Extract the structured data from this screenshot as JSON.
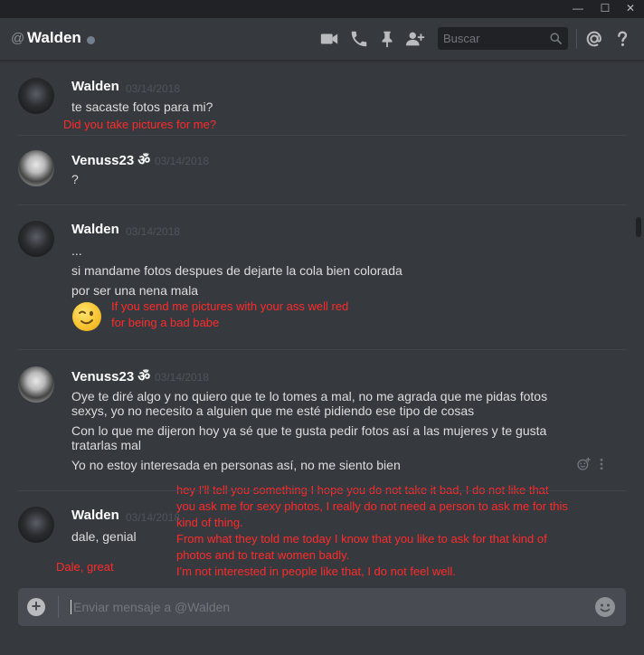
{
  "window": {
    "controls": [
      "—",
      "☐",
      "✕"
    ]
  },
  "header": {
    "at_symbol": "@",
    "channel_name": "Walden",
    "search_placeholder": "Buscar",
    "icons": [
      "video-call-icon",
      "voice-call-icon",
      "pin-icon",
      "add-friend-icon",
      "search-icon",
      "mention-icon",
      "help-icon"
    ]
  },
  "messages": [
    {
      "author": "Walden",
      "timestamp": "03/14/2018",
      "lines": [
        "te sacaste fotos para mi?"
      ],
      "overlay": [
        "Did you take pictures for me?"
      ]
    },
    {
      "author": "Venuss23 ॐ",
      "timestamp": "03/14/2018",
      "lines": [
        "?"
      ]
    },
    {
      "author": "Walden",
      "timestamp": "03/14/2018",
      "lines": [
        "...",
        "si mandame fotos despues de dejarte la cola bien colorada",
        "por ser una nena mala"
      ],
      "emoji": "wink",
      "overlay": [
        "If you send me pictures with your ass well red",
        "for being a bad babe"
      ]
    },
    {
      "author": "Venuss23 ॐ",
      "timestamp": "03/14/2018",
      "lines": [
        "Oye te diré algo y no quiero que te lo tomes a mal, no me agrada que me pidas fotos",
        "sexys, yo no necesito a alguien que me esté pidiendo ese tipo de cosas",
        "Con lo que me dijeron hoy ya sé que te gusta pedir fotos así a las mujeres y te gusta",
        "tratarlas mal",
        "Yo no estoy interesada en personas así, no me siento bien"
      ],
      "overlay": [
        "hey I'll tell you something I hope you do not take it bad, I do not like that",
        "you ask me for sexy photos, I really do not need a person to ask me for this",
        "kind of thing.",
        "From what they told me today I know that you like to ask for that kind of",
        "photos and to treat women badly.",
        "I'm not interested in people like that, I do not feel well."
      ]
    },
    {
      "author": "Walden",
      "timestamp": "03/14/2018",
      "lines": [
        "dale, genial"
      ],
      "overlay": [
        "Dale, great"
      ]
    }
  ],
  "composer": {
    "placeholder": "Enviar mensaje a @Walden"
  },
  "colors": {
    "background": "#36393e",
    "titlebar": "#202225",
    "overlay_text": "#ff2b2b",
    "composer": "#484c52"
  }
}
